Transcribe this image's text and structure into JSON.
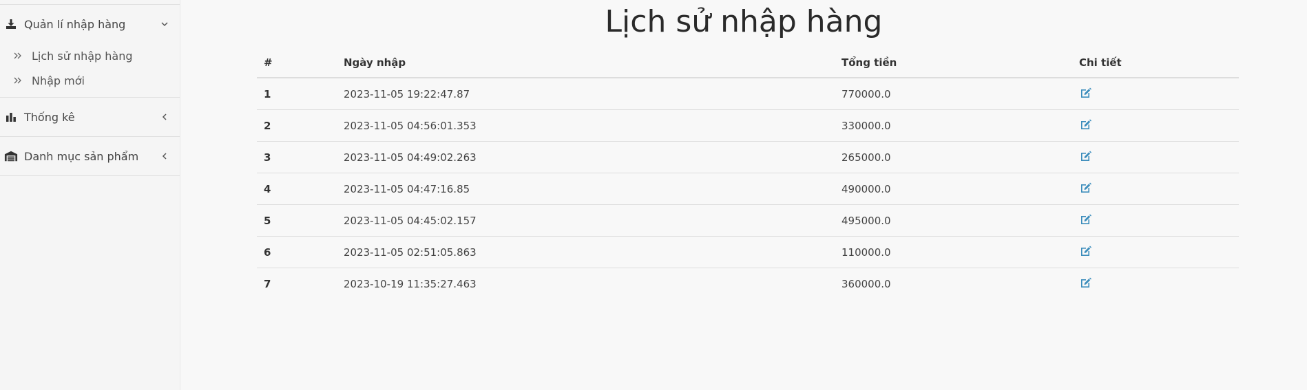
{
  "sidebar": {
    "groups": [
      {
        "label": "Quản lí nhập hàng",
        "icon": "download-tray-icon",
        "caret": "chevron-down-icon",
        "items": [
          {
            "label": "Lịch sử nhập hàng",
            "icon": "double-chevron-right-icon"
          },
          {
            "label": "Nhập mới",
            "icon": "double-chevron-right-icon"
          }
        ]
      },
      {
        "label": "Thống kê",
        "icon": "bar-chart-icon",
        "caret": "chevron-left-icon"
      },
      {
        "label": "Danh mục sản phẩm",
        "icon": "warehouse-icon",
        "caret": "chevron-left-icon"
      }
    ]
  },
  "main": {
    "title": "Lịch sử nhập hàng",
    "table": {
      "headers": [
        "#",
        "Ngày nhập",
        "Tổng tiền",
        "Chi tiết"
      ],
      "rows": [
        {
          "index": "1",
          "date": "2023-11-05 19:22:47.87",
          "total": "770000.0"
        },
        {
          "index": "2",
          "date": "2023-11-05 04:56:01.353",
          "total": "330000.0"
        },
        {
          "index": "3",
          "date": "2023-11-05 04:49:02.263",
          "total": "265000.0"
        },
        {
          "index": "4",
          "date": "2023-11-05 04:47:16.85",
          "total": "490000.0"
        },
        {
          "index": "5",
          "date": "2023-11-05 04:45:02.157",
          "total": "495000.0"
        },
        {
          "index": "6",
          "date": "2023-11-05 02:51:05.863",
          "total": "110000.0"
        },
        {
          "index": "7",
          "date": "2023-10-19 11:35:27.463",
          "total": "360000.0"
        }
      ],
      "detail_icon": "edit-icon"
    }
  },
  "colors": {
    "accent_icon": "#3c8dbc",
    "text_dark": "#333333",
    "sidebar_bg": "#f5f5f5",
    "page_bg": "#f8f8f8"
  }
}
